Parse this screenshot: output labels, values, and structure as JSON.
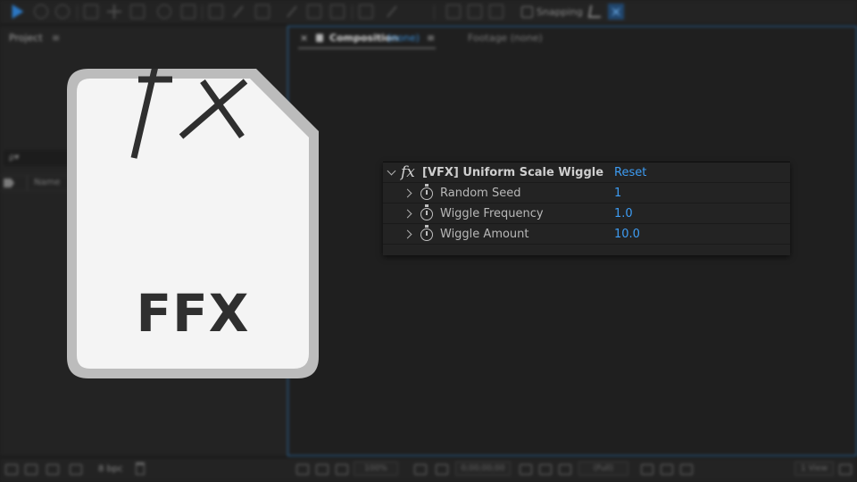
{
  "toolbar": {
    "snapping_label": "Snapping"
  },
  "project_panel": {
    "tab_label": "Project",
    "menu_glyph": "≡",
    "search_placeholder": "ρ▾",
    "name_column": "Name",
    "bpc_label": "8 bpc"
  },
  "composition_panel": {
    "close_glyph": "×",
    "tab_label": "Composition",
    "tab_value": "(none)",
    "menu_glyph": "≡",
    "footage_tab": "Footage (none)",
    "viewer_bar": [
      "100%",
      "0;00;00;00",
      "(Full)",
      "1 View"
    ]
  },
  "file_icon": {
    "symbol": "fx",
    "extension": "FFX",
    "colors": {
      "page": "#f4f4f4",
      "border": "#bcbcbc",
      "text": "#2f2f2f"
    }
  },
  "effect_panel": {
    "effect_name": "[VFX] Uniform Scale Wiggle",
    "fx_symbol": "fx",
    "reset_label": "Reset",
    "properties": [
      {
        "label": "Random Seed",
        "value": "1"
      },
      {
        "label": "Wiggle Frequency",
        "value": "1.0"
      },
      {
        "label": "Wiggle Amount",
        "value": "10.0"
      }
    ],
    "colors": {
      "value": "#3d9cf3",
      "panel": "#232323"
    }
  }
}
